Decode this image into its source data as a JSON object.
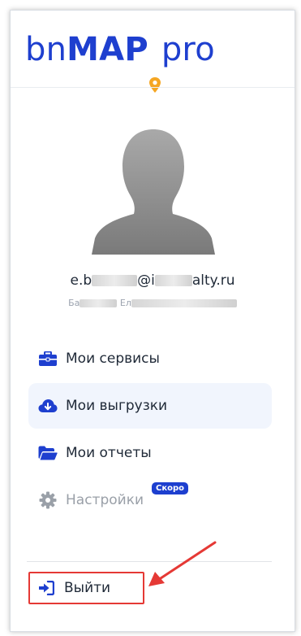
{
  "brand": {
    "part1": "bn",
    "part2": "MAP",
    "part3": "pro",
    "dot": "."
  },
  "profile": {
    "email_start": "e.b",
    "email_at": "@i",
    "email_end": "alty.ru",
    "name_start": "Ба",
    "name_middle": "Ел"
  },
  "menu": {
    "items": [
      {
        "label": "Мои сервисы",
        "icon": "briefcase-icon"
      },
      {
        "label": "Мои выгрузки",
        "icon": "cloud-download-icon"
      },
      {
        "label": "Мои отчеты",
        "icon": "folder-open-icon"
      },
      {
        "label": "Настройки",
        "icon": "gear-icon",
        "badge": "Скоро"
      }
    ]
  },
  "logout": {
    "label": "Выйти",
    "icon": "sign-in-icon"
  },
  "colors": {
    "brand": "#1e3fcf",
    "accent_pin": "#f5a623",
    "highlight": "#e53935",
    "active_bg": "#f1f5fd"
  }
}
